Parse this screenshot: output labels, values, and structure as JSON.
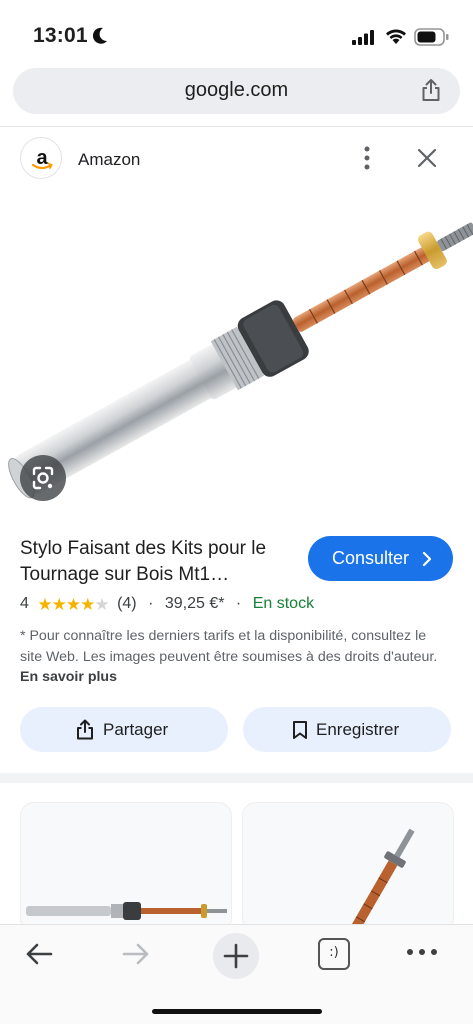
{
  "status_bar": {
    "time": "13:01",
    "icons": [
      "moon-icon",
      "cellular-signal-icon",
      "wifi-icon",
      "battery-icon"
    ]
  },
  "browser": {
    "url": "google.com",
    "url_action_icon": "share-icon"
  },
  "source": {
    "name": "Amazon",
    "logo_letter": "a",
    "actions": [
      "more-vert-icon",
      "close-icon"
    ]
  },
  "product": {
    "image_description_icon": "lens-search-icon",
    "title": "Stylo Faisant des Kits pour le Tournage sur Bois Mt1…",
    "visit_label": "Consulter",
    "rating_value": "4",
    "rating_stars": 4,
    "rating_max": 5,
    "review_count": "(4)",
    "price": "39,25 €*",
    "separator": "·",
    "availability": "En stock",
    "disclaimer": "* Pour connaître les derniers tarifs et la disponibilité, consultez le site Web. Les images peuvent être soumises à des droits d'auteur.",
    "learn_more": "En savoir plus"
  },
  "actions": {
    "share_label": "Partager",
    "save_label": "Enregistrer"
  },
  "toolbar": {
    "tabs_label": ":)",
    "icons": [
      "back-arrow-icon",
      "forward-arrow-icon",
      "plus-icon",
      "tabs-icon",
      "more-horiz-icon"
    ]
  },
  "colors": {
    "accent": "#1a73e8",
    "stock_green": "#188038",
    "star": "#f5b400",
    "pill_bg": "#e8f0fe"
  }
}
